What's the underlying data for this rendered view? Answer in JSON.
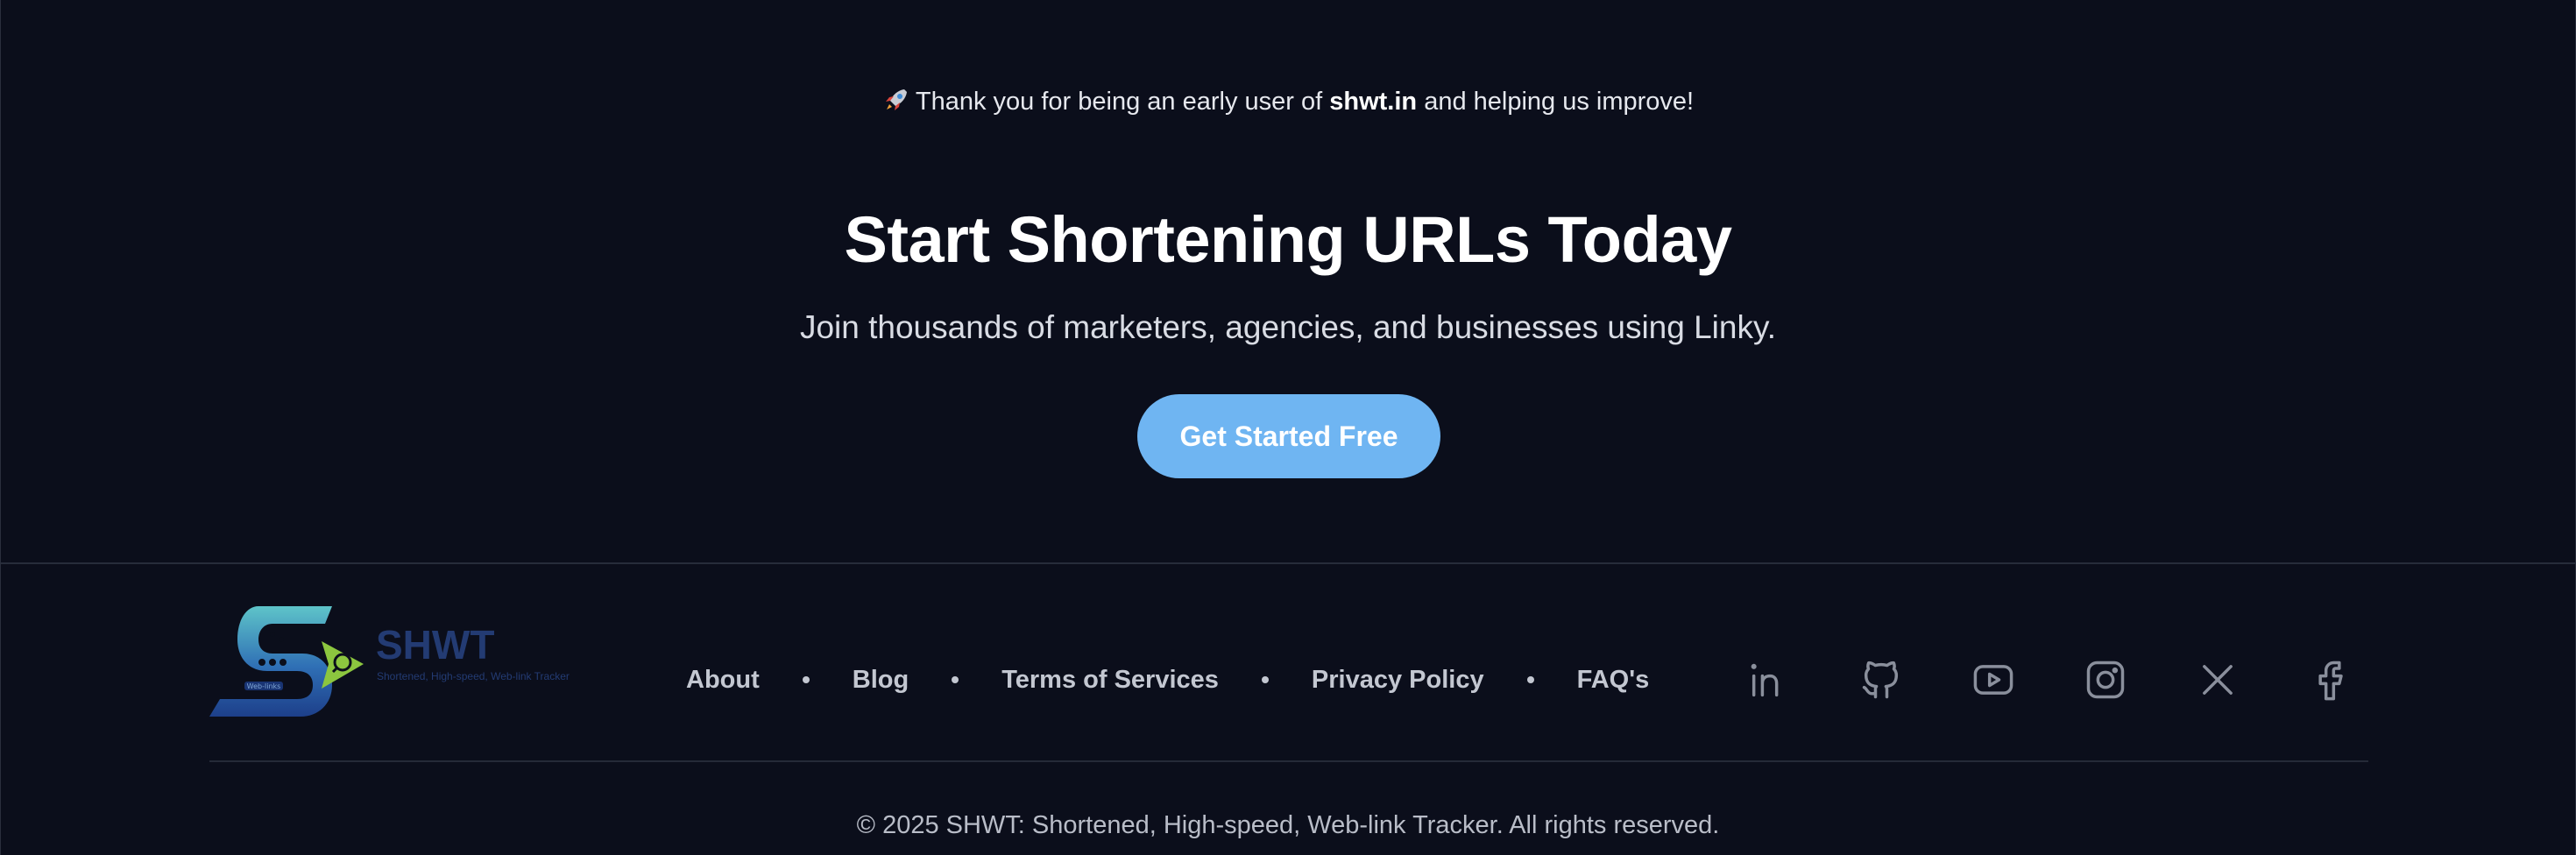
{
  "announcement": {
    "icon": "rocket-icon",
    "prefix": "Thank you for being an early user of",
    "brand": "shwt.in",
    "suffix": "and helping us improve!"
  },
  "cta": {
    "headline": "Start Shortening URLs Today",
    "subline": "Join thousands of marketers, agencies, and businesses using Linky.",
    "button_label": "Get Started Free",
    "button_color": "#6fb5f2"
  },
  "footer": {
    "logo": {
      "wordmark": "SHWT",
      "tagline": "Shortened, High-speed, Web-link Tracker",
      "badge": "Web-links"
    },
    "nav": [
      {
        "label": "About"
      },
      {
        "label": "Blog"
      },
      {
        "label": "Terms of Services"
      },
      {
        "label": "Privacy Policy"
      },
      {
        "label": "FAQ's"
      }
    ],
    "social_icons": [
      "linkedin-icon",
      "github-icon",
      "youtube-icon",
      "instagram-icon",
      "x-icon",
      "facebook-icon"
    ],
    "copyright": "© 2025 SHWT: Shortened, High-speed, Web-link Tracker. All rights reserved."
  },
  "colors": {
    "background": "#0b0e1b",
    "icon": "#8a8f9c",
    "link": "#c3c7d1"
  }
}
